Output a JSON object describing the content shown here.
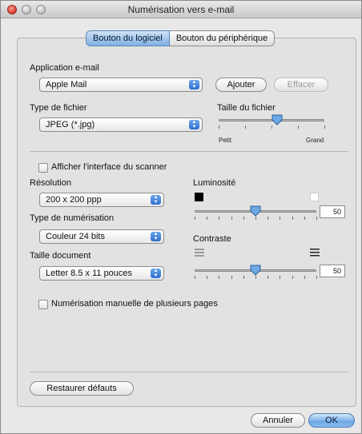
{
  "window": {
    "title": "Numérisation vers e-mail"
  },
  "tabs": [
    {
      "label": "Bouton du logiciel",
      "active": true
    },
    {
      "label": "Bouton du périphérique",
      "active": false
    }
  ],
  "email": {
    "label": "Application e-mail",
    "selected": "Apple Mail",
    "add_button": "Ajouter",
    "delete_button": "Effacer"
  },
  "file_type": {
    "label": "Type de fichier",
    "selected": "JPEG (*.jpg)"
  },
  "file_size": {
    "label": "Taille du fichier",
    "min_label": "Petit",
    "max_label": "Grand",
    "level": 0.55
  },
  "scanner_ui": {
    "label": "Afficher l'interface du scanner",
    "checked": false
  },
  "resolution": {
    "label": "Résolution",
    "selected": "200 x 200 ppp"
  },
  "scan_type": {
    "label": "Type de numérisation",
    "selected": "Couleur 24 bits"
  },
  "doc_size": {
    "label": "Taille document",
    "selected": "Letter  8.5 x 11 pouces"
  },
  "brightness": {
    "label": "Luminosité",
    "value": "50",
    "level": 0.5
  },
  "contrast": {
    "label": "Contraste",
    "value": "50",
    "level": 0.5
  },
  "manual_multi": {
    "label": "Numérisation manuelle de plusieurs pages",
    "checked": false
  },
  "buttons": {
    "restore": "Restaurer défauts",
    "cancel": "Annuler",
    "ok": "OK"
  },
  "colors": {
    "accent": "#6ea9e6",
    "tab_active": "#7fb0e4"
  },
  "icons": {
    "close": "close-traffic-light-icon",
    "minimize": "minimize-traffic-light-icon",
    "zoom": "zoom-traffic-light-icon",
    "popup_arrows": "updown-arrows-icon",
    "slider_knob": "slider-knob-icon",
    "dark_square": "dark-square-icon",
    "light_square": "light-square-icon",
    "low_contrast": "low-contrast-lines-icon",
    "high_contrast": "high-contrast-lines-icon"
  }
}
